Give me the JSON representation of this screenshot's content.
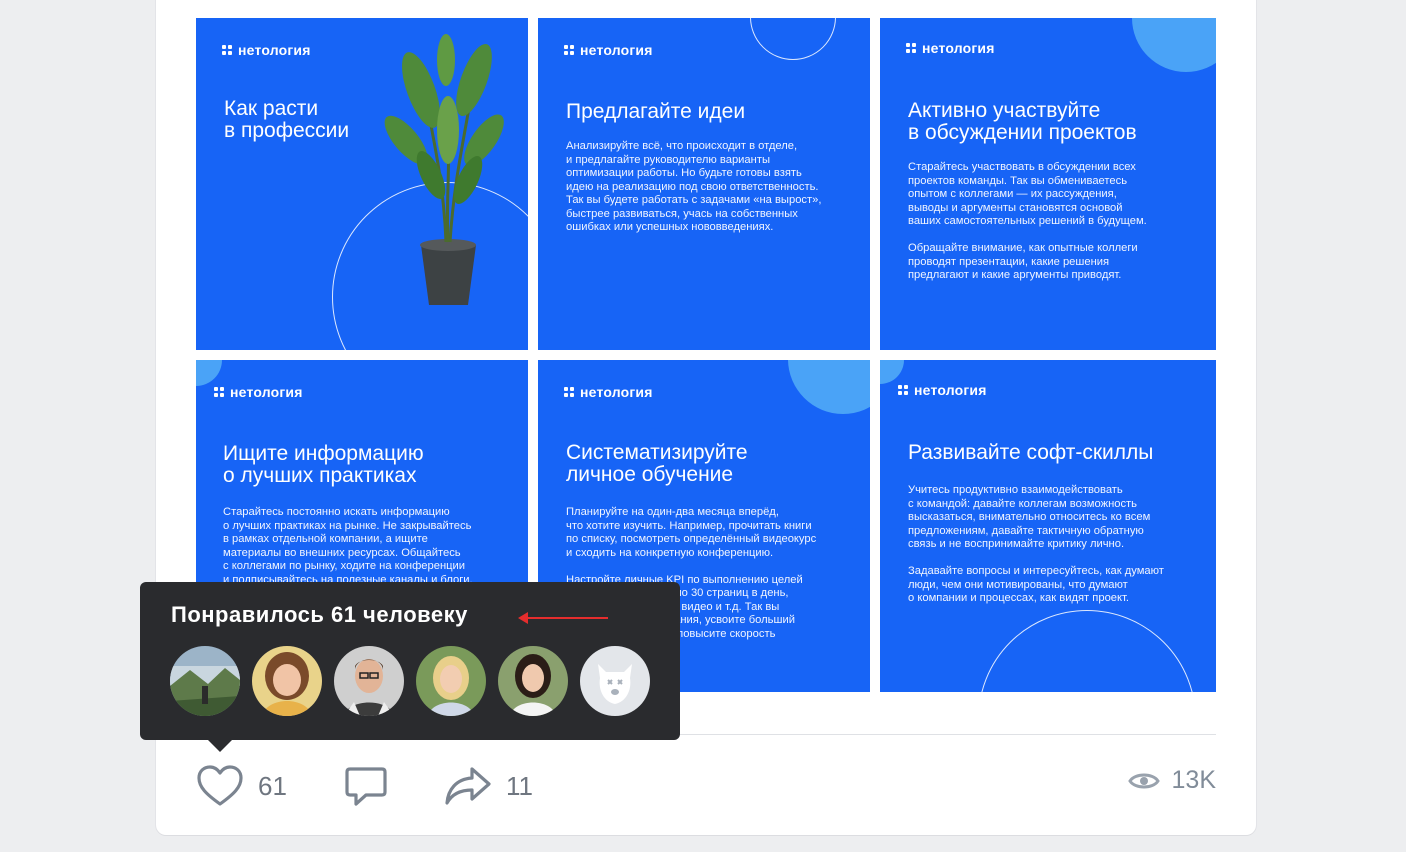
{
  "brand": "нетология",
  "tiles": [
    {
      "title": "Как расти\nв профессии",
      "body": ""
    },
    {
      "title": "Предлагайте идеи",
      "body": "Анализируйте всё, что происходит в отделе,\nи предлагайте руководителю варианты\nоптимизации работы. Но будьте готовы взять\nидею на реализацию под свою ответственность.\nТак вы будете работать с задачами «на вырост»,\nбыстрее развиваться, учась на собственных\nошибках или успешных нововведениях."
    },
    {
      "title": "Активно участвуйте\nв обсуждении проектов",
      "body": "Старайтесь участвовать в обсуждении всех\nпроектов команды. Так вы обмениваетесь\nопытом с коллегами — их рассуждения,\nвыводы и аргументы становятся основой\nваших самостоятельных решений в будущем.\n\nОбращайте внимание, как опытные коллеги\nпроводят презентации, какие решения\nпредлагают и какие аргументы приводят."
    },
    {
      "title": "Ищите информацию\nо лучших практиках",
      "body": "Старайтесь постоянно искать информацию\nо лучших практиках на рынке. Не закрывайтесь\nв рамках отдельной компании, а ищите\nматериалы во внешних ресурсах. Общайтесь\nс коллегами по рынку, ходите на конференции\nи подписывайтесь на полезные каналы и блоги."
    },
    {
      "title": "Систематизируйте\nличное обучение",
      "body": "Планируйте на один-два месяца вперёд,\nчто хотите изучить. Например, прочитать книги\nпо списку, посмотреть определённый видеокурс\nи сходить на конкретную конференцию.\n\nНастройте личные KPI по выполнению целей\nпо обучению: читать по 30 страниц в день,\nсмотреть по 15 минут видео и т.д. Так вы\nсистематизируете знания, усвоите больший\nобъём материалов и повысите скорость\nсамообучения."
    },
    {
      "title": "Развивайте софт-скиллы",
      "body": "Учитесь продуктивно взаимодействовать\nс командой: давайте коллегам возможность\nвысказаться, внимательно относитесь ко всем\nпредложениям, давайте тактичную обратную\nсвязь и не воспринимайте критику лично.\n\nЗадавайте вопросы и интересуйтесь, как думают\nлюди, чем они мотивированы, что думают\nо компании и процессах, как видят проект."
    }
  ],
  "tooltip": {
    "title": "Понравилось 61 человеку"
  },
  "actions": {
    "likes": "61",
    "shares": "11",
    "views": "13K"
  },
  "colors": {
    "tile_bg": "#1764f6",
    "accent_circle": "#4aa3f7",
    "annotation": "#e52d2d"
  }
}
